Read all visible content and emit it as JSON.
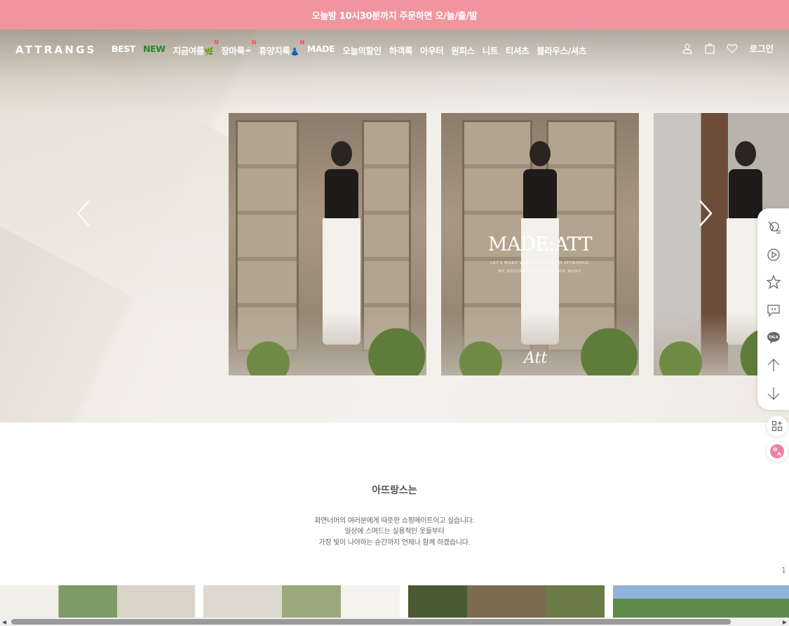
{
  "promo": {
    "text": "오늘밤 10시30분까지 주문하면 오/늘/출/발"
  },
  "header": {
    "logo": "ATTRANGS",
    "nav": [
      {
        "label": "BEST"
      },
      {
        "label": "NEW"
      },
      {
        "label": "지금여름",
        "emoji": "🌿",
        "badge": "N"
      },
      {
        "label": "장마룩",
        "emoji": "☔",
        "badge": "N"
      },
      {
        "label": "휴양지룩",
        "emoji": "👗",
        "badge": "N"
      },
      {
        "label": "MADE"
      },
      {
        "label": "오늘의할인"
      },
      {
        "label": "하객룩"
      },
      {
        "label": "아우터"
      },
      {
        "label": "원피스"
      },
      {
        "label": "니트"
      },
      {
        "label": "티셔츠"
      },
      {
        "label": "블라우스/셔츠"
      }
    ],
    "icons": [
      "user-icon",
      "bag-icon",
      "heart-icon"
    ],
    "login": "로그인",
    "new_color": "#1f8c2b"
  },
  "hero": {
    "slide_title": "MADE:ATT",
    "slide_sub_1": "LET'S MAKE YOUR STYLE WITH ATTRANGS.",
    "slide_sub_2": "WE SUGGEST THE STYLE YOU WANT.",
    "slide_sign": "Att"
  },
  "quick_menu": [
    "recent-view-icon",
    "live-play-icon",
    "favorite-star-icon",
    "chat-icon",
    "kakao-talk-icon",
    "scroll-up-icon",
    "scroll-down-icon"
  ],
  "about": {
    "title": "아뜨랑스는",
    "line1": "화면너머의 여러분에게 따뜻한 쇼핑메이트이고 싶습니다.",
    "line2": "일상에 스며드는 실용적인 옷들부터",
    "line3": "가장 빛이 나야하는 순간까지 언제나 함께 하겠습니다."
  },
  "pagination": "1",
  "colors": {
    "promo_bg": "#f0959d",
    "accent_pink": "#f07fa0"
  }
}
